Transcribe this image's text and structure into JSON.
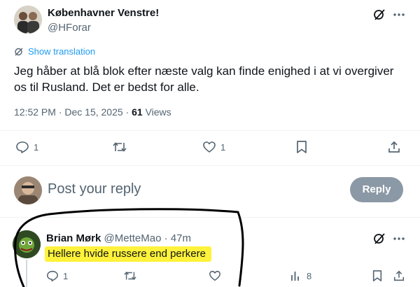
{
  "tweet": {
    "display_name": "Københavner Venstre!",
    "handle": "@HForar",
    "show_translation": "Show translation",
    "text_line1": "Jeg håber at blå blok efter næste valg kan finde enighed i at vi overgiver",
    "text_line2": "os til Rusland. Det er bedst for alle.",
    "time": "12:52 PM · Dec 15, 2025 ·",
    "views_count": "61",
    "views_label": "Views",
    "reply_count": "1",
    "like_count": "1",
    "icons": [
      "grok-slash-icon",
      "more-icon",
      "translate-icon",
      "reply-icon",
      "retweet-icon",
      "like-icon",
      "bookmark-icon",
      "share-icon"
    ]
  },
  "compose": {
    "placeholder": "Post your reply",
    "reply_button": "Reply"
  },
  "reply": {
    "display_name": "Brian Mørk",
    "handle": "@MetteMao",
    "age": "· 47m",
    "text": "Hellere hvide russere end perkere",
    "reply_count": "1",
    "views_count": "8",
    "highlight_color": "#fff23a",
    "annotation_color": "#000000"
  },
  "colors": {
    "text": "#0f1419",
    "muted": "#536471",
    "link": "#1d9bf0",
    "button_disabled": "#8b98a5"
  }
}
